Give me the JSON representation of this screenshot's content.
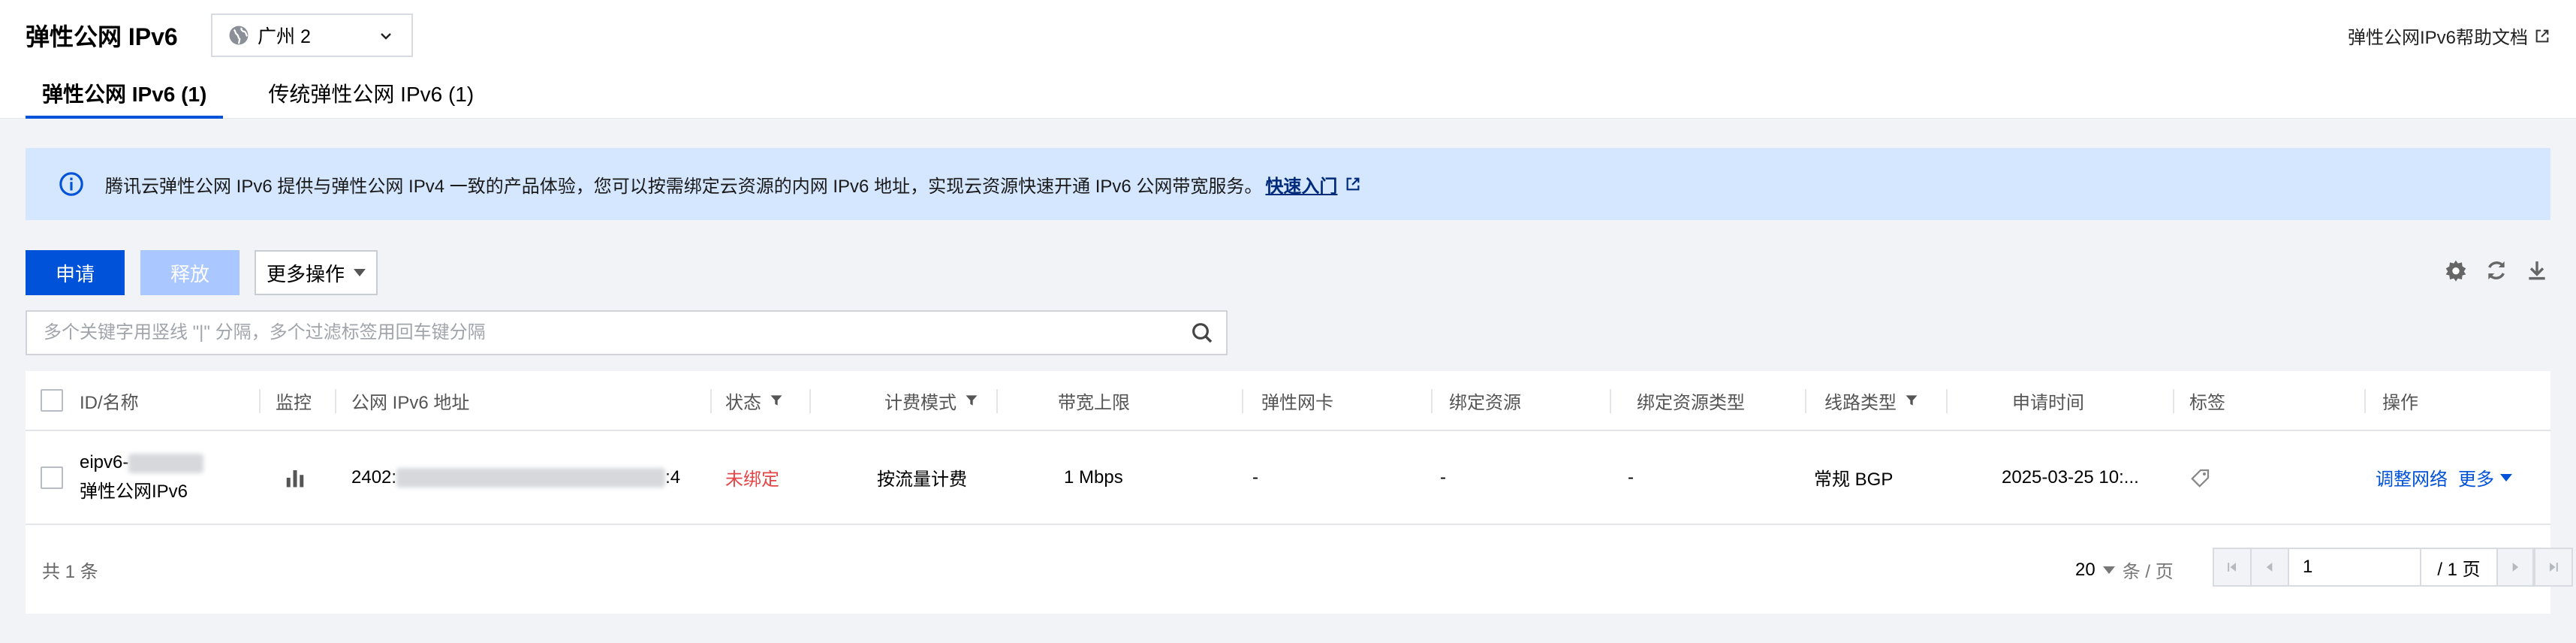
{
  "header": {
    "title": "弹性公网 IPv6",
    "region": "广州 2",
    "help_link": "弹性公网IPv6帮助文档",
    "tabs": [
      {
        "label": "弹性公网 IPv6 (1)",
        "active": true
      },
      {
        "label": "传统弹性公网 IPv6 (1)",
        "active": false
      }
    ]
  },
  "banner": {
    "text": "腾讯云弹性公网 IPv6 提供与弹性公网 IPv4 一致的产品体验，您可以按需绑定云资源的内网 IPv6 地址，实现云资源快速开通 IPv6 公网带宽服务。",
    "link": "快速入门"
  },
  "toolbar": {
    "apply": "申请",
    "release": "释放",
    "more": "更多操作"
  },
  "search": {
    "placeholder": "多个关键字用竖线 \"|\" 分隔，多个过滤标签用回车键分隔"
  },
  "table": {
    "columns": {
      "id_name": "ID/名称",
      "monitor": "监控",
      "ipv6": "公网 IPv6 地址",
      "status": "状态",
      "billing": "计费模式",
      "bandwidth": "带宽上限",
      "eni": "弹性网卡",
      "bound": "绑定资源",
      "bound_type": "绑定资源类型",
      "line": "线路类型",
      "time": "申请时间",
      "tags": "标签",
      "ops": "操作"
    },
    "rows": [
      {
        "id_prefix": "eipv6-",
        "name": "弹性公网IPv6",
        "ipv6_prefix": "2402:",
        "ipv6_suffix": ":4",
        "status": "未绑定",
        "billing": "按流量计费",
        "bandwidth": "1 Mbps",
        "eni": "-",
        "bound": "-",
        "bound_type": "-",
        "line": "常规 BGP",
        "time": "2025-03-25 10:...",
        "op_adjust": "调整网络",
        "op_more": "更多"
      }
    ]
  },
  "footer": {
    "total": "共 1 条",
    "page_size": "20",
    "page_size_unit": "条 / 页",
    "page_value": "1",
    "page_of": "/ 1 页"
  },
  "colors": {
    "primary": "#0052d9",
    "disabled": "#aac8ff",
    "banner_bg": "#d5e6ff",
    "status_red": "#e54545"
  }
}
